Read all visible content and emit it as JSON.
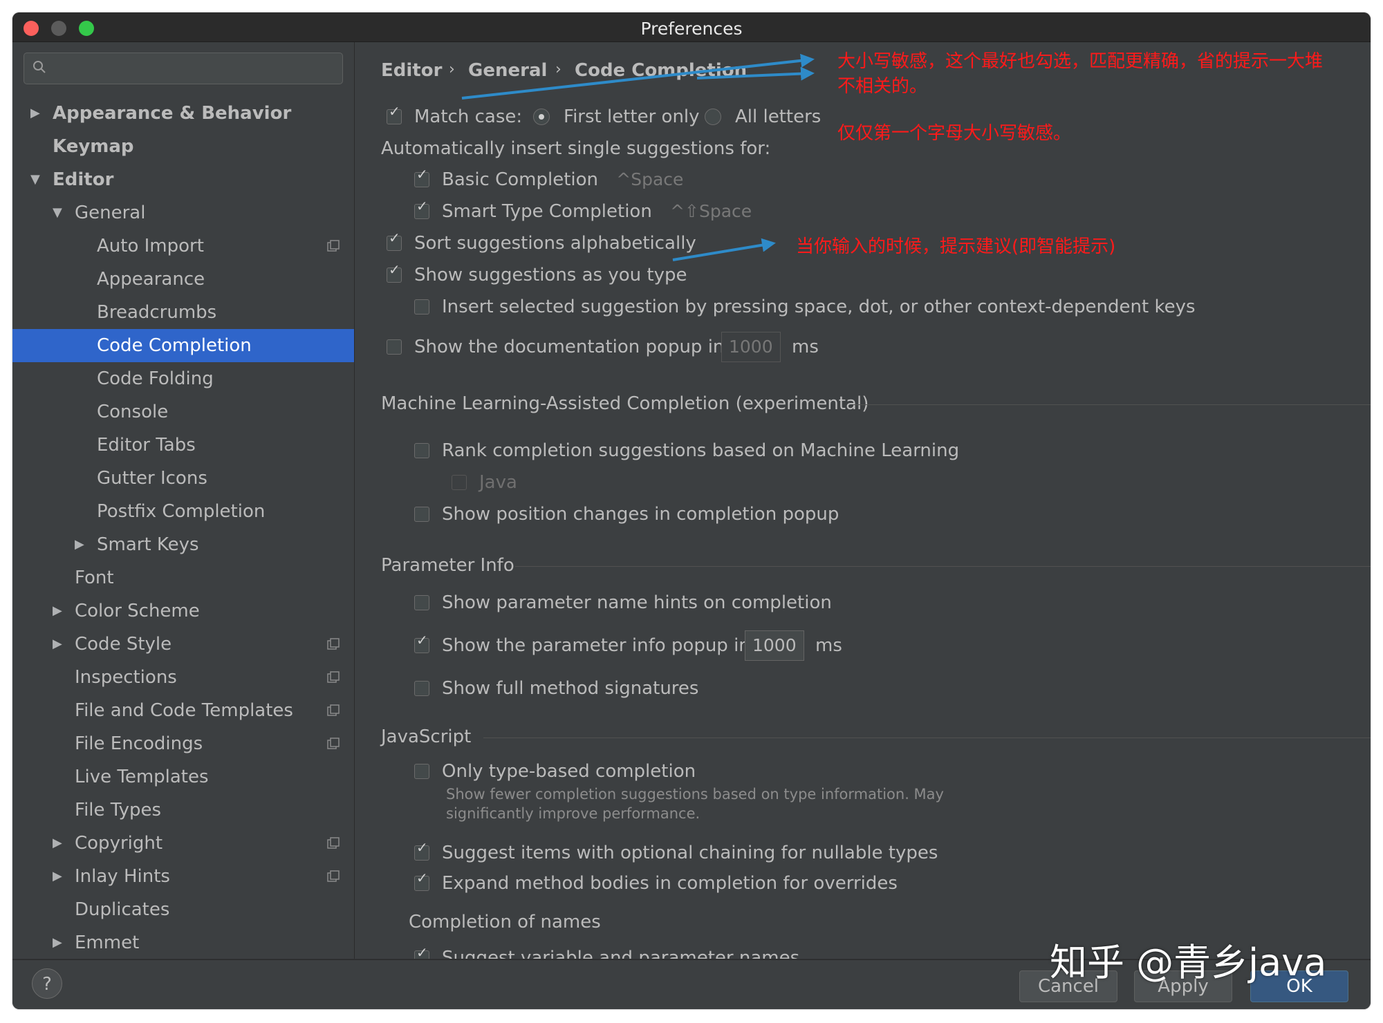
{
  "window": {
    "title": "Preferences"
  },
  "sidebar": {
    "search_placeholder": "",
    "items": [
      {
        "label": "Appearance & Behavior"
      },
      {
        "label": "Keymap"
      },
      {
        "label": "Editor"
      },
      {
        "label": "General"
      },
      {
        "label": "Auto Import"
      },
      {
        "label": "Appearance"
      },
      {
        "label": "Breadcrumbs"
      },
      {
        "label": "Code Completion"
      },
      {
        "label": "Code Folding"
      },
      {
        "label": "Console"
      },
      {
        "label": "Editor Tabs"
      },
      {
        "label": "Gutter Icons"
      },
      {
        "label": "Postfix Completion"
      },
      {
        "label": "Smart Keys"
      },
      {
        "label": "Font"
      },
      {
        "label": "Color Scheme"
      },
      {
        "label": "Code Style"
      },
      {
        "label": "Inspections"
      },
      {
        "label": "File and Code Templates"
      },
      {
        "label": "File Encodings"
      },
      {
        "label": "Live Templates"
      },
      {
        "label": "File Types"
      },
      {
        "label": "Copyright"
      },
      {
        "label": "Inlay Hints"
      },
      {
        "label": "Duplicates"
      },
      {
        "label": "Emmet"
      }
    ],
    "selected": "Code Completion"
  },
  "breadcrumb": {
    "items": [
      "Editor",
      "General",
      "Code Completion"
    ],
    "separator": "›"
  },
  "completion": {
    "match_case": {
      "label": "Match case:",
      "checked": true
    },
    "first_letter": {
      "label": "First letter only",
      "selected": true
    },
    "all_letters": {
      "label": "All letters",
      "selected": false
    },
    "auto_insert_heading": "Automatically insert single suggestions for:",
    "basic": {
      "label": "Basic Completion",
      "shortcut": "^Space",
      "checked": true
    },
    "smart_type": {
      "label": "Smart Type Completion",
      "shortcut": "^⇧Space",
      "checked": true
    },
    "sort_alpha": {
      "label": "Sort suggestions alphabetically",
      "checked": true
    },
    "show_as_type": {
      "label": "Show suggestions as you type",
      "checked": true
    },
    "insert_selected": {
      "label": "Insert selected suggestion by pressing space, dot, or other context-dependent keys",
      "checked": false
    },
    "doc_popup": {
      "label": "Show the documentation popup in",
      "value": "1000",
      "unit": "ms",
      "checked": false
    }
  },
  "ml": {
    "title": "Machine Learning-Assisted Completion (experimental)",
    "rank": {
      "label": "Rank completion suggestions based on Machine Learning",
      "checked": false
    },
    "java": {
      "label": "Java",
      "checked": false
    },
    "position_changes": {
      "label": "Show position changes in completion popup",
      "checked": false
    }
  },
  "param_info": {
    "title": "Parameter Info",
    "name_hints": {
      "label": "Show parameter name hints on completion",
      "checked": false
    },
    "info_popup": {
      "label": "Show the parameter info popup in",
      "value": "1000",
      "unit": "ms",
      "checked": true
    },
    "full_sig": {
      "label": "Show full method signatures",
      "checked": false
    }
  },
  "javascript": {
    "title": "JavaScript",
    "type_based": {
      "label": "Only type-based completion",
      "checked": false
    },
    "type_based_hint_1": "Show fewer completion suggestions based on type information. May",
    "type_based_hint_2": "significantly improve performance.",
    "optional_chaining": {
      "label": "Suggest items with optional chaining for nullable types",
      "checked": true
    },
    "expand_bodies": {
      "label": "Expand method bodies in completion for overrides",
      "checked": true
    },
    "completion_of_names": "Completion of names",
    "suggest_var": {
      "label": "Suggest variable and parameter names",
      "checked": true
    }
  },
  "annotations": {
    "match_case_note_1": "大小写敏感，这个最好也勾选，匹配更精确，省的提示一大堆",
    "match_case_note_2": "不相关的。",
    "first_letter_note": "仅仅第一个字母大小写敏感。",
    "as_you_type_note": "当你输入的时候，提示建议(即智能提示)",
    "color": "#ff1a1a",
    "arrow_color": "#2e8bc9"
  },
  "footer": {
    "help": "?",
    "cancel": "Cancel",
    "apply": "Apply",
    "ok": "OK"
  },
  "watermark": "知乎 @青乡java"
}
